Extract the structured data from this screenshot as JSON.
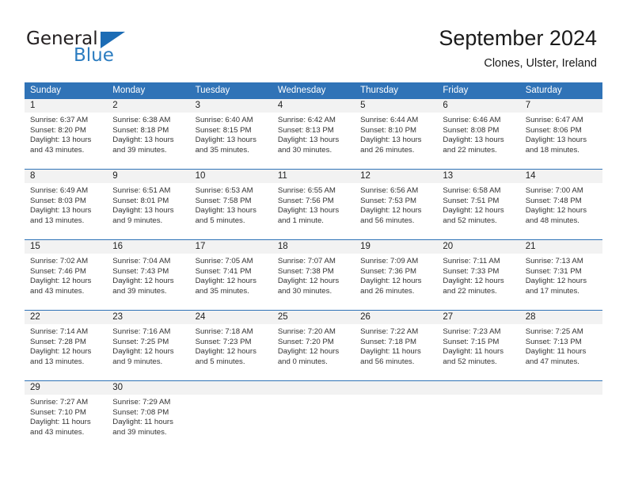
{
  "brand": {
    "name_part1": "General",
    "name_part2": "Blue",
    "flag_icon": "triangle-flag-icon",
    "accent_color": "#1c6cb5"
  },
  "header": {
    "title": "September 2024",
    "subtitle": "Clones, Ulster, Ireland"
  },
  "theme": {
    "header_blue": "#3073b7",
    "day_band_gray": "#f2f2f2",
    "week_rule_blue": "#3073b7"
  },
  "weekdays": [
    "Sunday",
    "Monday",
    "Tuesday",
    "Wednesday",
    "Thursday",
    "Friday",
    "Saturday"
  ],
  "weeks": [
    [
      {
        "day": "1",
        "sunrise": "Sunrise: 6:37 AM",
        "sunset": "Sunset: 8:20 PM",
        "daylight_line1": "Daylight: 13 hours",
        "daylight_line2": "and 43 minutes."
      },
      {
        "day": "2",
        "sunrise": "Sunrise: 6:38 AM",
        "sunset": "Sunset: 8:18 PM",
        "daylight_line1": "Daylight: 13 hours",
        "daylight_line2": "and 39 minutes."
      },
      {
        "day": "3",
        "sunrise": "Sunrise: 6:40 AM",
        "sunset": "Sunset: 8:15 PM",
        "daylight_line1": "Daylight: 13 hours",
        "daylight_line2": "and 35 minutes."
      },
      {
        "day": "4",
        "sunrise": "Sunrise: 6:42 AM",
        "sunset": "Sunset: 8:13 PM",
        "daylight_line1": "Daylight: 13 hours",
        "daylight_line2": "and 30 minutes."
      },
      {
        "day": "5",
        "sunrise": "Sunrise: 6:44 AM",
        "sunset": "Sunset: 8:10 PM",
        "daylight_line1": "Daylight: 13 hours",
        "daylight_line2": "and 26 minutes."
      },
      {
        "day": "6",
        "sunrise": "Sunrise: 6:46 AM",
        "sunset": "Sunset: 8:08 PM",
        "daylight_line1": "Daylight: 13 hours",
        "daylight_line2": "and 22 minutes."
      },
      {
        "day": "7",
        "sunrise": "Sunrise: 6:47 AM",
        "sunset": "Sunset: 8:06 PM",
        "daylight_line1": "Daylight: 13 hours",
        "daylight_line2": "and 18 minutes."
      }
    ],
    [
      {
        "day": "8",
        "sunrise": "Sunrise: 6:49 AM",
        "sunset": "Sunset: 8:03 PM",
        "daylight_line1": "Daylight: 13 hours",
        "daylight_line2": "and 13 minutes."
      },
      {
        "day": "9",
        "sunrise": "Sunrise: 6:51 AM",
        "sunset": "Sunset: 8:01 PM",
        "daylight_line1": "Daylight: 13 hours",
        "daylight_line2": "and 9 minutes."
      },
      {
        "day": "10",
        "sunrise": "Sunrise: 6:53 AM",
        "sunset": "Sunset: 7:58 PM",
        "daylight_line1": "Daylight: 13 hours",
        "daylight_line2": "and 5 minutes."
      },
      {
        "day": "11",
        "sunrise": "Sunrise: 6:55 AM",
        "sunset": "Sunset: 7:56 PM",
        "daylight_line1": "Daylight: 13 hours",
        "daylight_line2": "and 1 minute."
      },
      {
        "day": "12",
        "sunrise": "Sunrise: 6:56 AM",
        "sunset": "Sunset: 7:53 PM",
        "daylight_line1": "Daylight: 12 hours",
        "daylight_line2": "and 56 minutes."
      },
      {
        "day": "13",
        "sunrise": "Sunrise: 6:58 AM",
        "sunset": "Sunset: 7:51 PM",
        "daylight_line1": "Daylight: 12 hours",
        "daylight_line2": "and 52 minutes."
      },
      {
        "day": "14",
        "sunrise": "Sunrise: 7:00 AM",
        "sunset": "Sunset: 7:48 PM",
        "daylight_line1": "Daylight: 12 hours",
        "daylight_line2": "and 48 minutes."
      }
    ],
    [
      {
        "day": "15",
        "sunrise": "Sunrise: 7:02 AM",
        "sunset": "Sunset: 7:46 PM",
        "daylight_line1": "Daylight: 12 hours",
        "daylight_line2": "and 43 minutes."
      },
      {
        "day": "16",
        "sunrise": "Sunrise: 7:04 AM",
        "sunset": "Sunset: 7:43 PM",
        "daylight_line1": "Daylight: 12 hours",
        "daylight_line2": "and 39 minutes."
      },
      {
        "day": "17",
        "sunrise": "Sunrise: 7:05 AM",
        "sunset": "Sunset: 7:41 PM",
        "daylight_line1": "Daylight: 12 hours",
        "daylight_line2": "and 35 minutes."
      },
      {
        "day": "18",
        "sunrise": "Sunrise: 7:07 AM",
        "sunset": "Sunset: 7:38 PM",
        "daylight_line1": "Daylight: 12 hours",
        "daylight_line2": "and 30 minutes."
      },
      {
        "day": "19",
        "sunrise": "Sunrise: 7:09 AM",
        "sunset": "Sunset: 7:36 PM",
        "daylight_line1": "Daylight: 12 hours",
        "daylight_line2": "and 26 minutes."
      },
      {
        "day": "20",
        "sunrise": "Sunrise: 7:11 AM",
        "sunset": "Sunset: 7:33 PM",
        "daylight_line1": "Daylight: 12 hours",
        "daylight_line2": "and 22 minutes."
      },
      {
        "day": "21",
        "sunrise": "Sunrise: 7:13 AM",
        "sunset": "Sunset: 7:31 PM",
        "daylight_line1": "Daylight: 12 hours",
        "daylight_line2": "and 17 minutes."
      }
    ],
    [
      {
        "day": "22",
        "sunrise": "Sunrise: 7:14 AM",
        "sunset": "Sunset: 7:28 PM",
        "daylight_line1": "Daylight: 12 hours",
        "daylight_line2": "and 13 minutes."
      },
      {
        "day": "23",
        "sunrise": "Sunrise: 7:16 AM",
        "sunset": "Sunset: 7:25 PM",
        "daylight_line1": "Daylight: 12 hours",
        "daylight_line2": "and 9 minutes."
      },
      {
        "day": "24",
        "sunrise": "Sunrise: 7:18 AM",
        "sunset": "Sunset: 7:23 PM",
        "daylight_line1": "Daylight: 12 hours",
        "daylight_line2": "and 5 minutes."
      },
      {
        "day": "25",
        "sunrise": "Sunrise: 7:20 AM",
        "sunset": "Sunset: 7:20 PM",
        "daylight_line1": "Daylight: 12 hours",
        "daylight_line2": "and 0 minutes."
      },
      {
        "day": "26",
        "sunrise": "Sunrise: 7:22 AM",
        "sunset": "Sunset: 7:18 PM",
        "daylight_line1": "Daylight: 11 hours",
        "daylight_line2": "and 56 minutes."
      },
      {
        "day": "27",
        "sunrise": "Sunrise: 7:23 AM",
        "sunset": "Sunset: 7:15 PM",
        "daylight_line1": "Daylight: 11 hours",
        "daylight_line2": "and 52 minutes."
      },
      {
        "day": "28",
        "sunrise": "Sunrise: 7:25 AM",
        "sunset": "Sunset: 7:13 PM",
        "daylight_line1": "Daylight: 11 hours",
        "daylight_line2": "and 47 minutes."
      }
    ],
    [
      {
        "day": "29",
        "sunrise": "Sunrise: 7:27 AM",
        "sunset": "Sunset: 7:10 PM",
        "daylight_line1": "Daylight: 11 hours",
        "daylight_line2": "and 43 minutes."
      },
      {
        "day": "30",
        "sunrise": "Sunrise: 7:29 AM",
        "sunset": "Sunset: 7:08 PM",
        "daylight_line1": "Daylight: 11 hours",
        "daylight_line2": "and 39 minutes."
      },
      {
        "day": "",
        "sunrise": "",
        "sunset": "",
        "daylight_line1": "",
        "daylight_line2": ""
      },
      {
        "day": "",
        "sunrise": "",
        "sunset": "",
        "daylight_line1": "",
        "daylight_line2": ""
      },
      {
        "day": "",
        "sunrise": "",
        "sunset": "",
        "daylight_line1": "",
        "daylight_line2": ""
      },
      {
        "day": "",
        "sunrise": "",
        "sunset": "",
        "daylight_line1": "",
        "daylight_line2": ""
      },
      {
        "day": "",
        "sunrise": "",
        "sunset": "",
        "daylight_line1": "",
        "daylight_line2": ""
      }
    ]
  ]
}
